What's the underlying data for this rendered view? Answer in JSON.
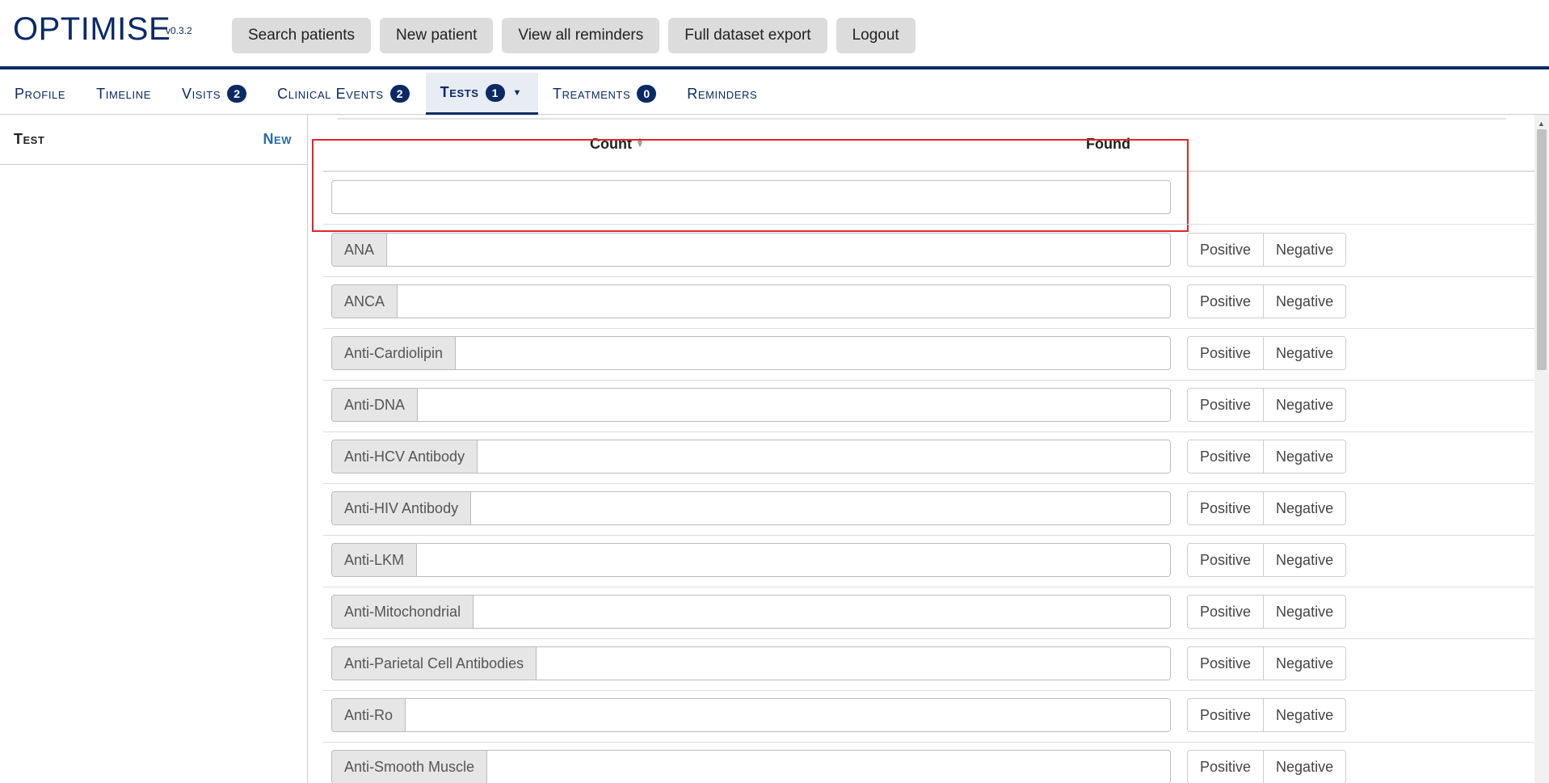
{
  "brand": {
    "name": "OPTIMISE",
    "version": "v0.3.2"
  },
  "nav": [
    "Search patients",
    "New patient",
    "View all reminders",
    "Full dataset export",
    "Logout"
  ],
  "tabs": [
    {
      "label": "Profile",
      "badge": null
    },
    {
      "label": "Timeline",
      "badge": null
    },
    {
      "label": "Visits",
      "badge": "2"
    },
    {
      "label": "Clinical Events",
      "badge": "2"
    },
    {
      "label": "Tests",
      "badge": "1",
      "active": true,
      "dropdown": true
    },
    {
      "label": "Treatments",
      "badge": "0"
    },
    {
      "label": "Reminders",
      "badge": null
    }
  ],
  "sidebar": {
    "title": "Test",
    "new_label": "New"
  },
  "table": {
    "count_header": "Count",
    "found_header": "Found",
    "filter_value": "",
    "rows": [
      "ANA",
      "ANCA",
      "Anti-Cardiolipin",
      "Anti-DNA",
      "Anti-HCV Antibody",
      "Anti-HIV Antibody",
      "Anti-LKM",
      "Anti-Mitochondrial",
      "Anti-Parietal Cell Antibodies",
      "Anti-Ro",
      "Anti-Smooth Muscle"
    ],
    "positive_label": "Positive",
    "negative_label": "Negative"
  },
  "colors": {
    "brand": "#0a2a66",
    "highlight": "#e0262c",
    "link": "#2b6cb0"
  },
  "icons": {
    "sort": "sort-icon",
    "dropdown": "caret-down-icon"
  }
}
